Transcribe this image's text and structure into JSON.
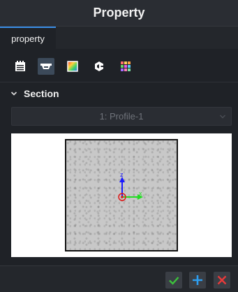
{
  "panel": {
    "title": "Property"
  },
  "tabs": [
    {
      "label": "property",
      "active": true
    }
  ],
  "toolbar": {
    "buttons": [
      {
        "icon": "notes-icon",
        "active": false
      },
      {
        "icon": "profile-section-icon",
        "active": true
      },
      {
        "icon": "texture-color-icon",
        "active": false
      },
      {
        "icon": "contour-icon",
        "active": false
      },
      {
        "icon": "palette-grid-icon",
        "active": false
      }
    ]
  },
  "section": {
    "title": "Section",
    "expanded": true,
    "profile_select": {
      "value": "1: Profile-1",
      "disabled": true
    }
  },
  "preview": {
    "axis_labels": {
      "z": "z",
      "x": "x"
    },
    "colors": {
      "z_axis": "#1a1aff",
      "x_axis": "#22dd22",
      "origin": "#e01818"
    }
  },
  "footer": {
    "buttons": [
      {
        "icon": "check-icon",
        "color": "#3cc23c"
      },
      {
        "icon": "plus-icon",
        "color": "#2d9ef0"
      },
      {
        "icon": "close-icon",
        "color": "#e83a3a"
      }
    ]
  }
}
